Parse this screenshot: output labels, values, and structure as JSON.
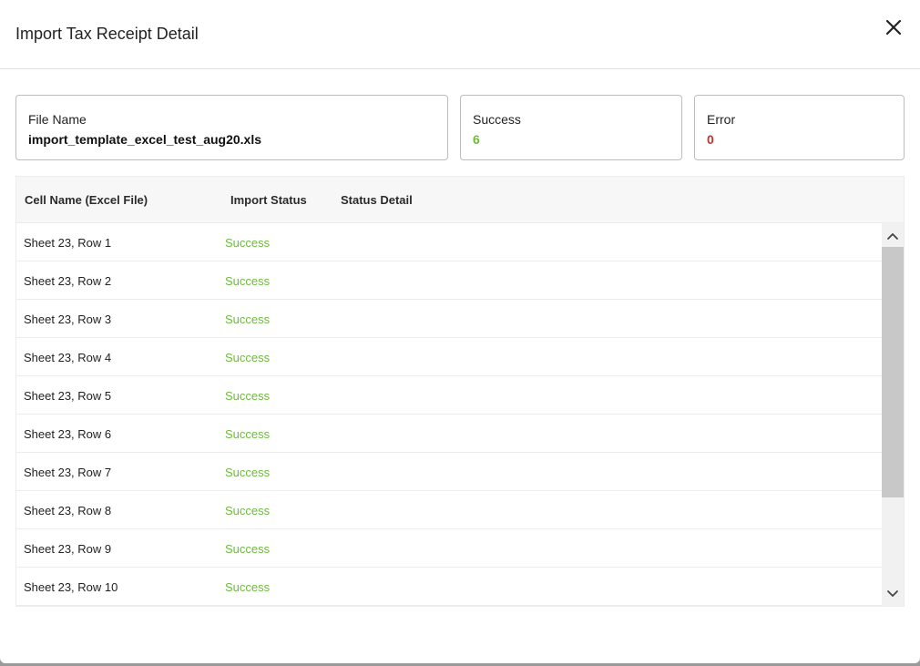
{
  "modal": {
    "title": "Import Tax Receipt Detail",
    "close_icon": "close-icon"
  },
  "summary": {
    "file": {
      "label": "File Name",
      "value": "import_template_excel_test_aug20.xls"
    },
    "success": {
      "label": "Success",
      "value": "6",
      "color": "#6dbb3d"
    },
    "error": {
      "label": "Error",
      "value": "0",
      "color": "#d0302a"
    }
  },
  "table": {
    "columns": [
      "Cell Name (Excel File)",
      "Import Status",
      "Status Detail"
    ],
    "rows": [
      {
        "cell": "Sheet 23, Row 1",
        "status": "Success",
        "detail": ""
      },
      {
        "cell": "Sheet 23, Row 2",
        "status": "Success",
        "detail": ""
      },
      {
        "cell": "Sheet 23, Row 3",
        "status": "Success",
        "detail": ""
      },
      {
        "cell": "Sheet 23, Row 4",
        "status": "Success",
        "detail": ""
      },
      {
        "cell": "Sheet 23, Row 5",
        "status": "Success",
        "detail": ""
      },
      {
        "cell": "Sheet 23, Row 6",
        "status": "Success",
        "detail": ""
      },
      {
        "cell": "Sheet 23, Row 7",
        "status": "Success",
        "detail": ""
      },
      {
        "cell": "Sheet 23, Row 8",
        "status": "Success",
        "detail": ""
      },
      {
        "cell": "Sheet 23, Row 9",
        "status": "Success",
        "detail": ""
      },
      {
        "cell": "Sheet 23, Row 10",
        "status": "Success",
        "detail": ""
      }
    ]
  },
  "scrollbar": {
    "up_icon": "chevron-up-icon",
    "down_icon": "chevron-down-icon"
  }
}
